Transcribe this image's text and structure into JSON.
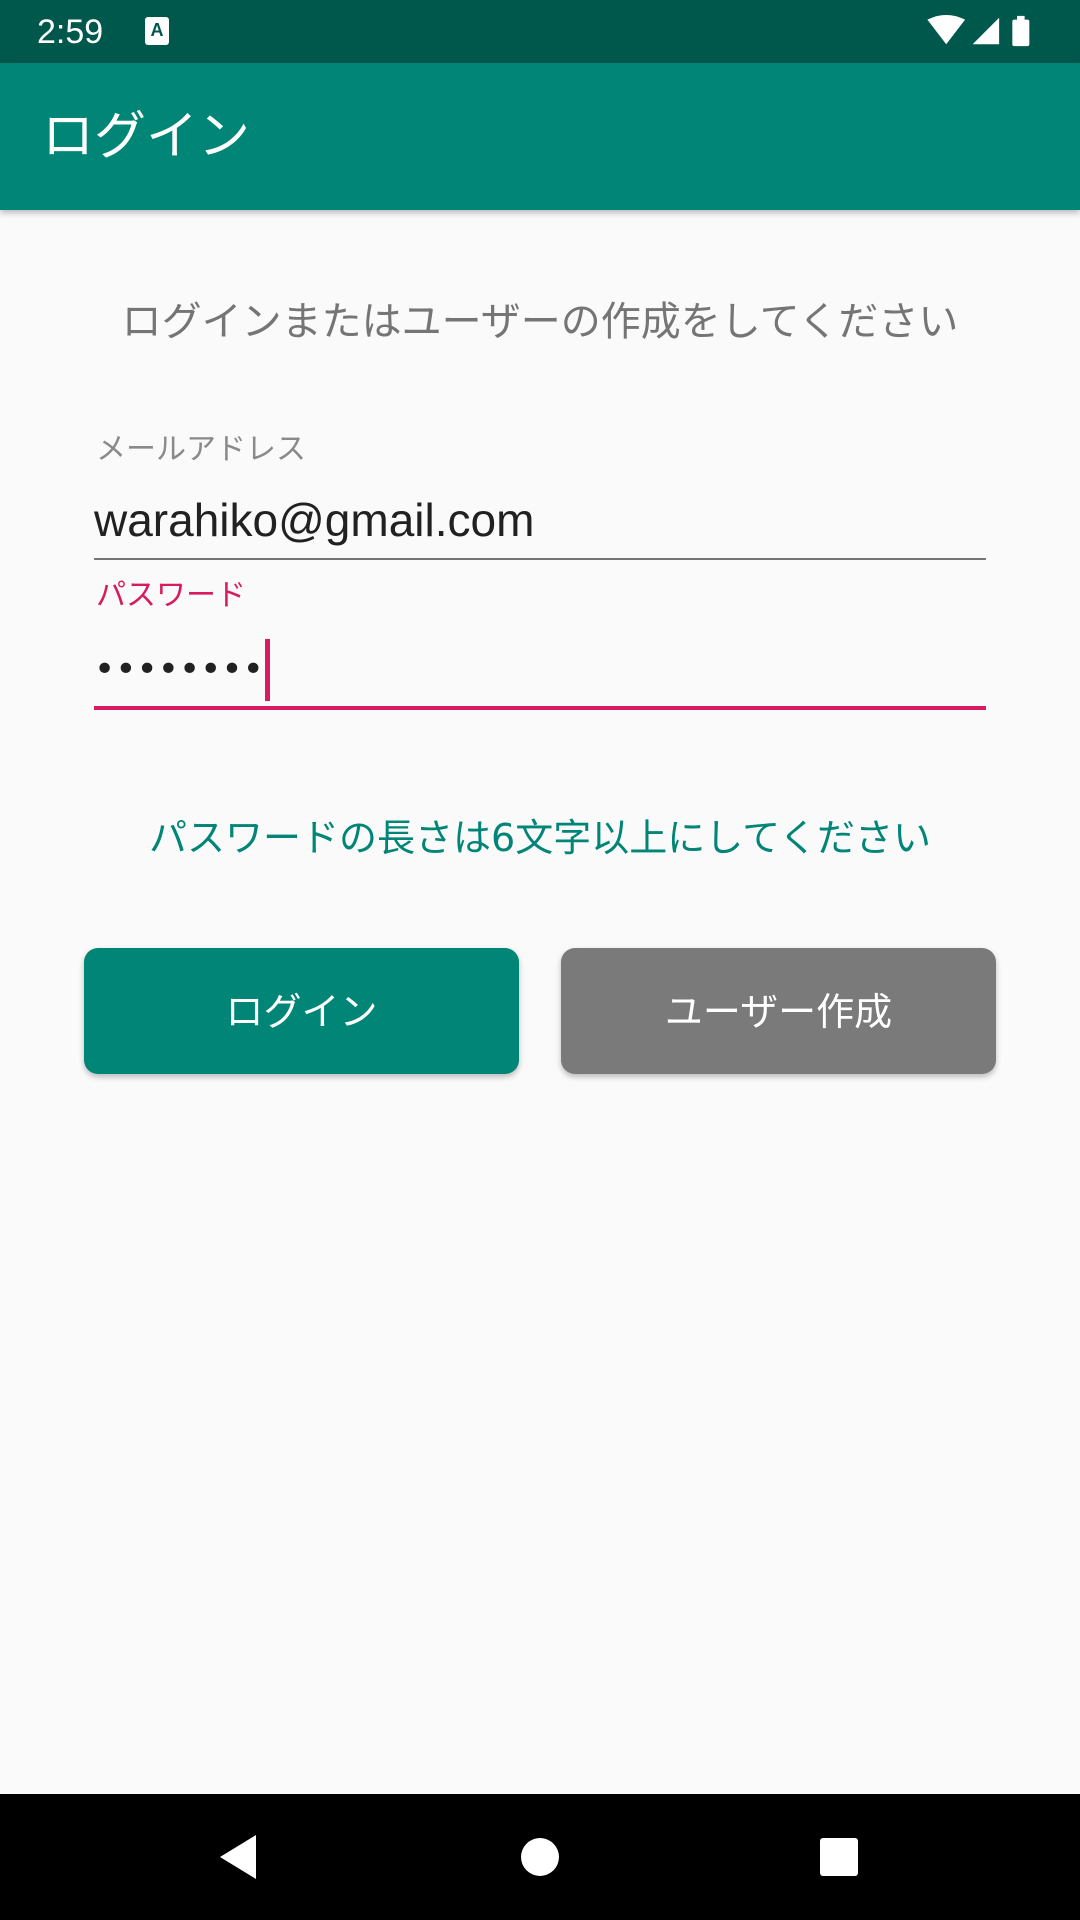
{
  "status_bar": {
    "time": "2:59",
    "notification_icon": "keyboard-a-icon",
    "notification_glyph": "A",
    "icons": [
      "wifi-icon",
      "cell-signal-icon",
      "battery-icon"
    ]
  },
  "app_bar": {
    "title": "ログイン"
  },
  "main": {
    "instruction": "ログインまたはユーザーの作成をしてください",
    "email": {
      "label": "メールアドレス",
      "value": "warahiko@gmail.com"
    },
    "password": {
      "label": "パスワード",
      "masked_value": "••••••••"
    },
    "error_message": "パスワードの長さは6文字以上にしてください",
    "login_button": "ログイン",
    "create_user_button": "ユーザー作成"
  },
  "nav_bar": {
    "buttons": [
      "back-icon",
      "home-icon",
      "recents-icon"
    ]
  },
  "colors": {
    "status_bar": "#00574B",
    "primary": "#008577",
    "accent": "#D81B60",
    "secondary_button": "#7A7A7A",
    "background": "#FAFAFA"
  }
}
